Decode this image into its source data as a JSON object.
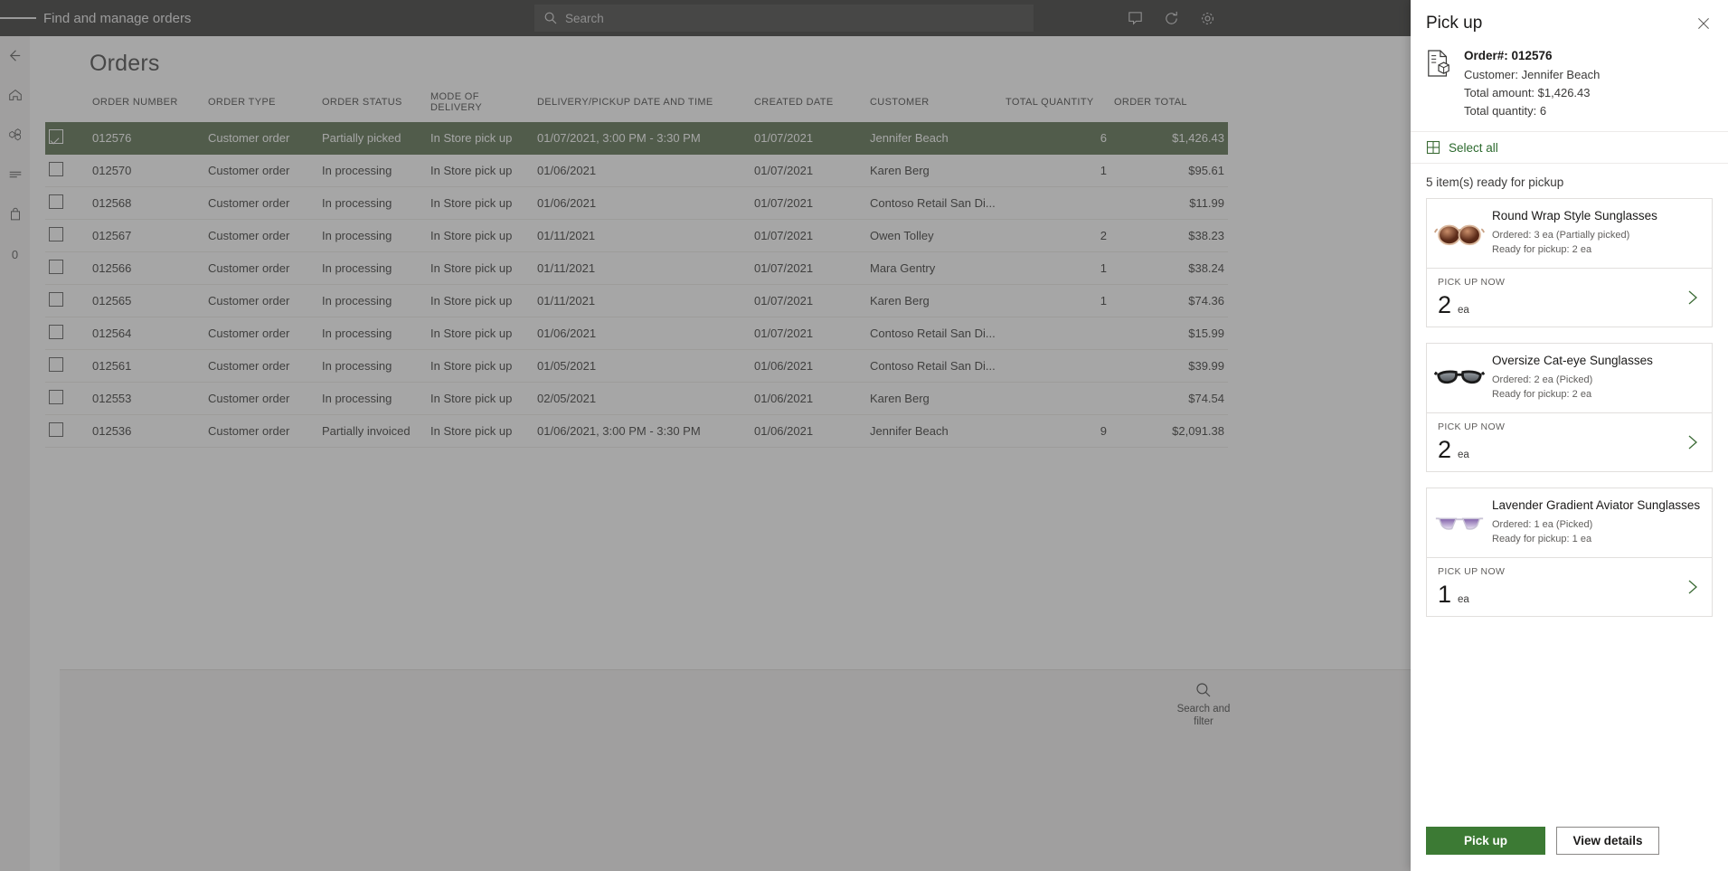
{
  "topbar": {
    "app_title": "Find and manage orders",
    "search_placeholder": "Search",
    "icons": [
      "menu-icon",
      "search-icon",
      "comment-icon",
      "refresh-icon",
      "settings-icon"
    ]
  },
  "left_rail": {
    "items": [
      {
        "icon": "back-arrow-icon",
        "label": ""
      },
      {
        "icon": "home-icon",
        "label": ""
      },
      {
        "icon": "products-icon",
        "label": ""
      },
      {
        "icon": "list-icon",
        "label": ""
      },
      {
        "icon": "bag-icon",
        "label": ""
      },
      {
        "icon": "cart-count",
        "label": "0"
      }
    ],
    "cart_count": "0"
  },
  "page": {
    "title": "Orders"
  },
  "bottom_bar": {
    "search_filter_label": "Search and filter"
  },
  "table": {
    "columns": [
      "ORDER NUMBER",
      "ORDER TYPE",
      "ORDER STATUS",
      "MODE OF DELIVERY",
      "DELIVERY/PICKUP DATE AND TIME",
      "CREATED DATE",
      "CUSTOMER",
      "TOTAL QUANTITY",
      "ORDER TOTAL"
    ],
    "rows": [
      {
        "selected": true,
        "order_number": "012576",
        "order_type": "Customer order",
        "order_status": "Partially picked",
        "mode_of_delivery": "In Store pick up",
        "delivery_datetime": "01/07/2021, 3:00 PM - 3:30 PM",
        "created_date": "01/07/2021",
        "customer": "Jennifer Beach",
        "total_quantity": "6",
        "order_total": "$1,426.43"
      },
      {
        "selected": false,
        "order_number": "012570",
        "order_type": "Customer order",
        "order_status": "In processing",
        "mode_of_delivery": "In Store pick up",
        "delivery_datetime": "01/06/2021",
        "created_date": "01/07/2021",
        "customer": "Karen Berg",
        "total_quantity": "1",
        "order_total": "$95.61"
      },
      {
        "selected": false,
        "order_number": "012568",
        "order_type": "Customer order",
        "order_status": "In processing",
        "mode_of_delivery": "In Store pick up",
        "delivery_datetime": "01/06/2021",
        "created_date": "01/07/2021",
        "customer": "Contoso Retail San Di...",
        "total_quantity": "",
        "order_total": "$11.99"
      },
      {
        "selected": false,
        "order_number": "012567",
        "order_type": "Customer order",
        "order_status": "In processing",
        "mode_of_delivery": "In Store pick up",
        "delivery_datetime": "01/11/2021",
        "created_date": "01/07/2021",
        "customer": "Owen Tolley",
        "total_quantity": "2",
        "order_total": "$38.23"
      },
      {
        "selected": false,
        "order_number": "012566",
        "order_type": "Customer order",
        "order_status": "In processing",
        "mode_of_delivery": "In Store pick up",
        "delivery_datetime": "01/11/2021",
        "created_date": "01/07/2021",
        "customer": "Mara Gentry",
        "total_quantity": "1",
        "order_total": "$38.24"
      },
      {
        "selected": false,
        "order_number": "012565",
        "order_type": "Customer order",
        "order_status": "In processing",
        "mode_of_delivery": "In Store pick up",
        "delivery_datetime": "01/11/2021",
        "created_date": "01/07/2021",
        "customer": "Karen Berg",
        "total_quantity": "1",
        "order_total": "$74.36"
      },
      {
        "selected": false,
        "order_number": "012564",
        "order_type": "Customer order",
        "order_status": "In processing",
        "mode_of_delivery": "In Store pick up",
        "delivery_datetime": "01/06/2021",
        "created_date": "01/07/2021",
        "customer": "Contoso Retail San Di...",
        "total_quantity": "",
        "order_total": "$15.99"
      },
      {
        "selected": false,
        "order_number": "012561",
        "order_type": "Customer order",
        "order_status": "In processing",
        "mode_of_delivery": "In Store pick up",
        "delivery_datetime": "01/05/2021",
        "created_date": "01/06/2021",
        "customer": "Contoso Retail San Di...",
        "total_quantity": "",
        "order_total": "$39.99"
      },
      {
        "selected": false,
        "order_number": "012553",
        "order_type": "Customer order",
        "order_status": "In processing",
        "mode_of_delivery": "In Store pick up",
        "delivery_datetime": "02/05/2021",
        "created_date": "01/06/2021",
        "customer": "Karen Berg",
        "total_quantity": "",
        "order_total": "$74.54"
      },
      {
        "selected": false,
        "order_number": "012536",
        "order_type": "Customer order",
        "order_status": "Partially invoiced",
        "mode_of_delivery": "In Store pick up",
        "delivery_datetime": "01/06/2021, 3:00 PM - 3:30 PM",
        "created_date": "01/06/2021",
        "customer": "Jennifer Beach",
        "total_quantity": "9",
        "order_total": "$2,091.38"
      }
    ]
  },
  "panel": {
    "title": "Pick up",
    "close_icon": "close-icon",
    "order": {
      "icon": "order-document-icon",
      "order_number_label": "Order#: 012576",
      "customer_label": "Customer: Jennifer Beach",
      "total_amount_label": "Total amount: $1,426.43",
      "total_quantity_label": "Total quantity: 6"
    },
    "select_all_label": "Select all",
    "ready_count_label": "5 item(s) ready for pickup",
    "qty_label": "PICK UP NOW",
    "items": [
      {
        "thumb": "round-wrap-sunglasses-thumb",
        "name": "Round Wrap Style Sunglasses",
        "ordered": "Ordered: 3 ea (Partially picked)",
        "ready": "Ready for pickup: 2 ea",
        "pick_up_now_qty": "2",
        "unit": "ea"
      },
      {
        "thumb": "oversize-cateye-sunglasses-thumb",
        "name": "Oversize Cat-eye Sunglasses",
        "ordered": "Ordered: 2 ea (Picked)",
        "ready": "Ready for pickup: 2 ea",
        "pick_up_now_qty": "2",
        "unit": "ea"
      },
      {
        "thumb": "lavender-aviator-sunglasses-thumb",
        "name": "Lavender Gradient Aviator Sunglasses",
        "ordered": "Ordered: 1 ea (Picked)",
        "ready": "Ready for pickup: 1 ea",
        "pick_up_now_qty": "1",
        "unit": "ea"
      }
    ],
    "footer": {
      "primary_label": "Pick up",
      "secondary_label": "View details"
    }
  },
  "colors": {
    "topbar_bg": "#3b3a39",
    "selected_row": "#5c7151",
    "accent_green": "#3c7a34",
    "link_green": "#2c6a2e"
  }
}
